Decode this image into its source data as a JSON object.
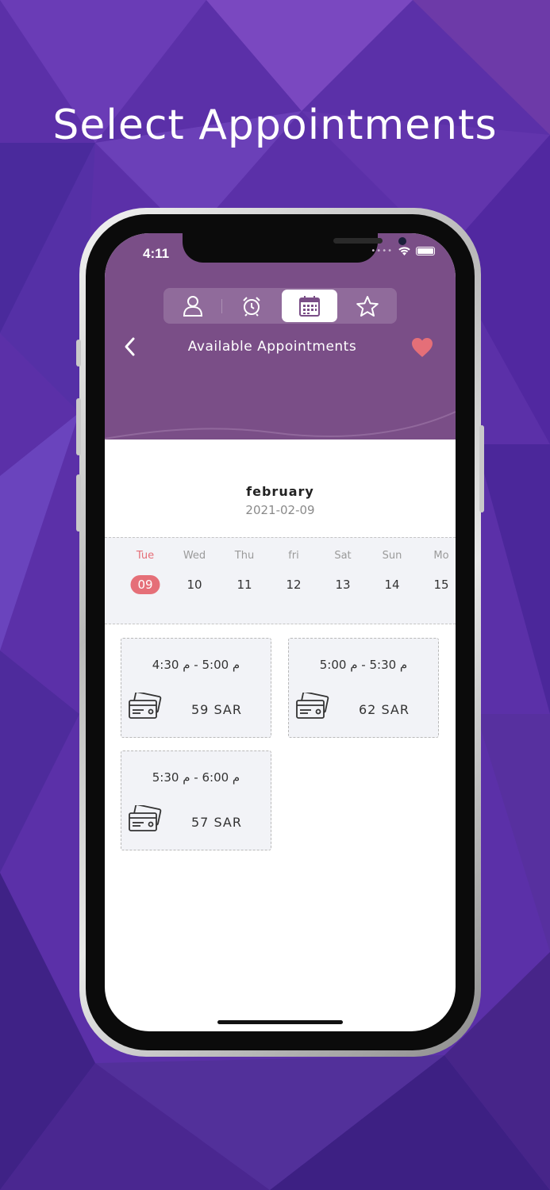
{
  "headline": "Select Appointments",
  "status_bar": {
    "time": "4:11"
  },
  "tabs": [
    {
      "icon": "user-icon",
      "active": false
    },
    {
      "icon": "alarm-clock-icon",
      "active": false
    },
    {
      "icon": "calendar-icon",
      "active": true
    },
    {
      "icon": "star-icon",
      "active": false
    }
  ],
  "header": {
    "title": "Available Appointments",
    "back_icon": "chevron-left-icon",
    "favorite_icon": "heart-icon"
  },
  "selected": {
    "month": "february",
    "date": "2021-02-09"
  },
  "days": [
    {
      "name": "Tue",
      "num": "09",
      "selected": true
    },
    {
      "name": "Wed",
      "num": "10"
    },
    {
      "name": "Thu",
      "num": "11"
    },
    {
      "name": "fri",
      "num": "12"
    },
    {
      "name": "Sat",
      "num": "13"
    },
    {
      "name": "Sun",
      "num": "14"
    },
    {
      "name": "Mo",
      "num": "15"
    }
  ],
  "slots": [
    {
      "time": "م 5:00 - م 4:30",
      "price": "59 SAR"
    },
    {
      "time": "م 5:30 - م 5:00",
      "price": "62 SAR"
    },
    {
      "time": "م 6:00 - م 5:30",
      "price": "57 SAR"
    }
  ],
  "colors": {
    "header": "#7a4e87",
    "accent": "#e56f78",
    "background": "#5a2fa6"
  }
}
